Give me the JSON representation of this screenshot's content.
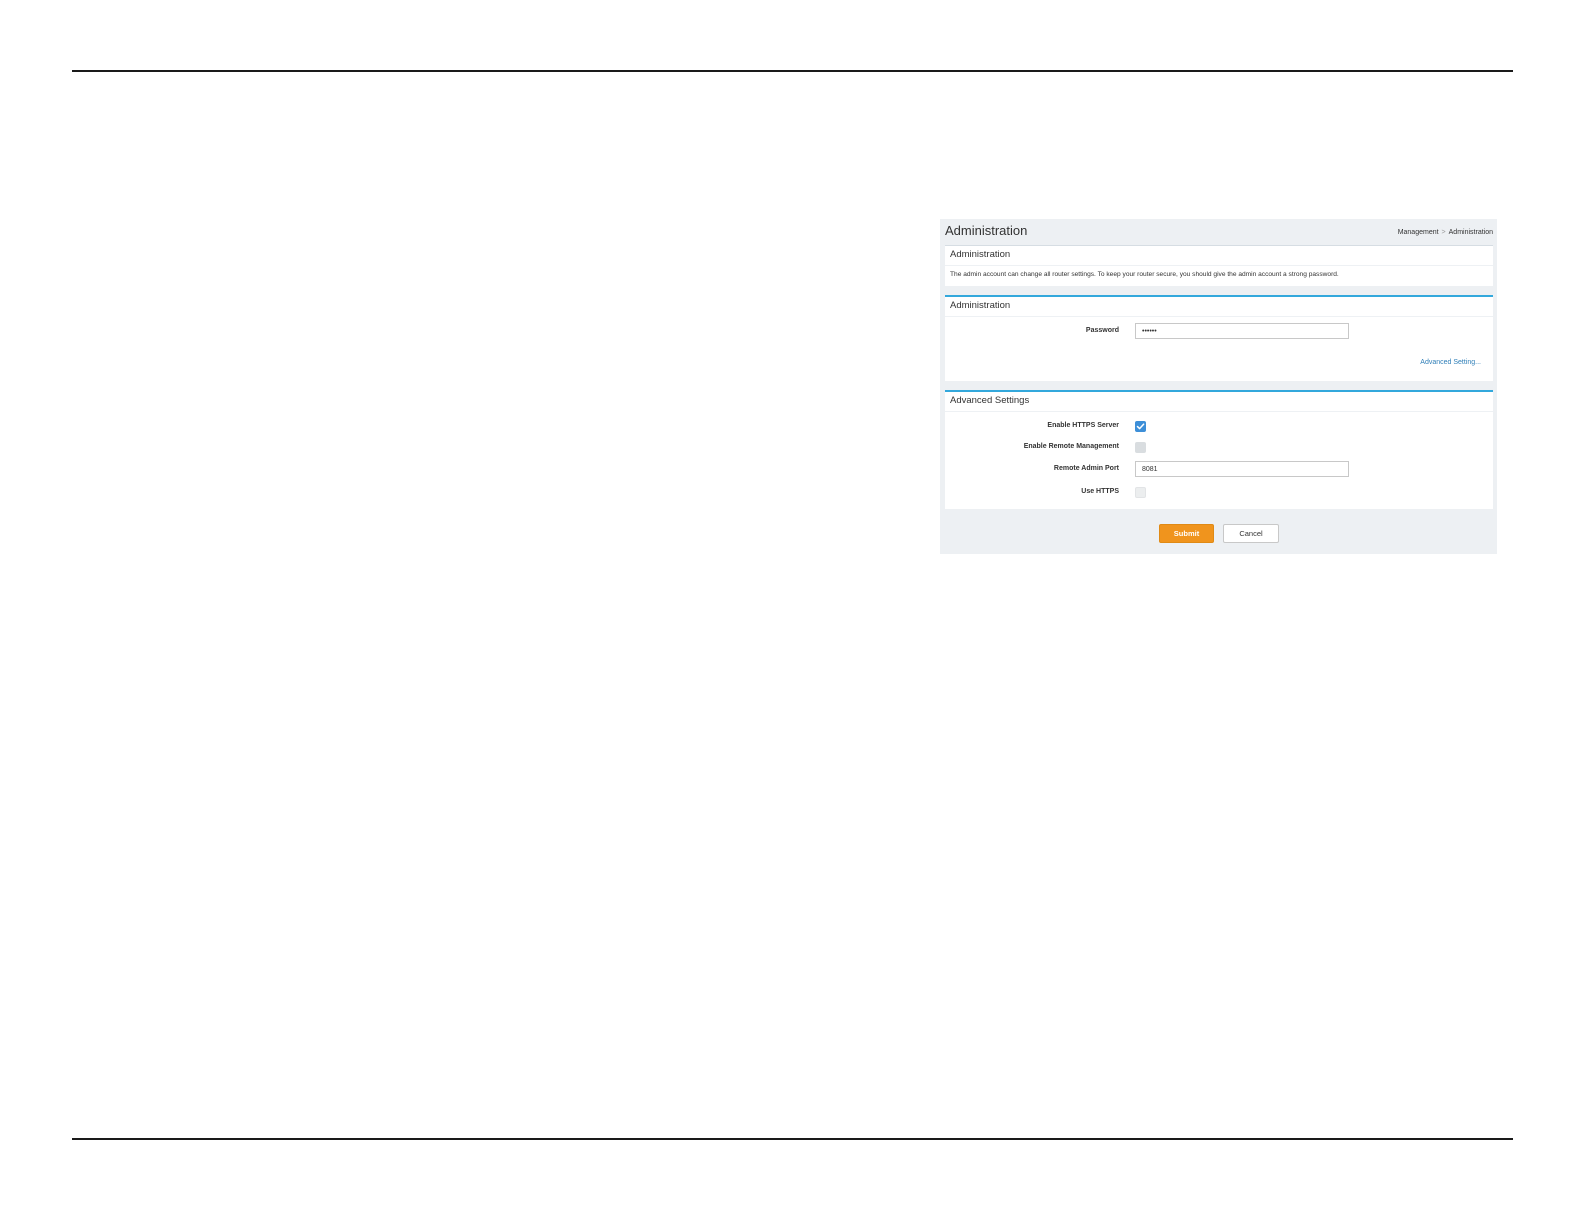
{
  "page": {
    "title": "Administration",
    "breadcrumb": {
      "parent": "Management",
      "separator": ">",
      "current": "Administration"
    }
  },
  "info_panel": {
    "title": "Administration",
    "text": "The admin account can change all router settings. To keep your router secure, you should give the admin account a strong password."
  },
  "admin_panel": {
    "title": "Administration",
    "password_label": "Password",
    "password_value": "••••••",
    "advanced_link": "Advanced Setting..."
  },
  "advanced_panel": {
    "title": "Advanced Settings",
    "https_server_label": "Enable HTTPS Server",
    "https_server_checked": true,
    "remote_mgmt_label": "Enable Remote Management",
    "remote_mgmt_checked": false,
    "remote_port_label": "Remote Admin Port",
    "remote_port_value": "8081",
    "use_https_label": "Use HTTPS",
    "use_https_checked": false
  },
  "buttons": {
    "submit": "Submit",
    "cancel": "Cancel"
  },
  "colors": {
    "accent_blue": "#33a8dc",
    "checkbox_blue": "#3d8fd8",
    "submit_orange": "#f0941d",
    "link_blue": "#2f7fb8"
  },
  "icons": {
    "checked": "check-icon"
  }
}
